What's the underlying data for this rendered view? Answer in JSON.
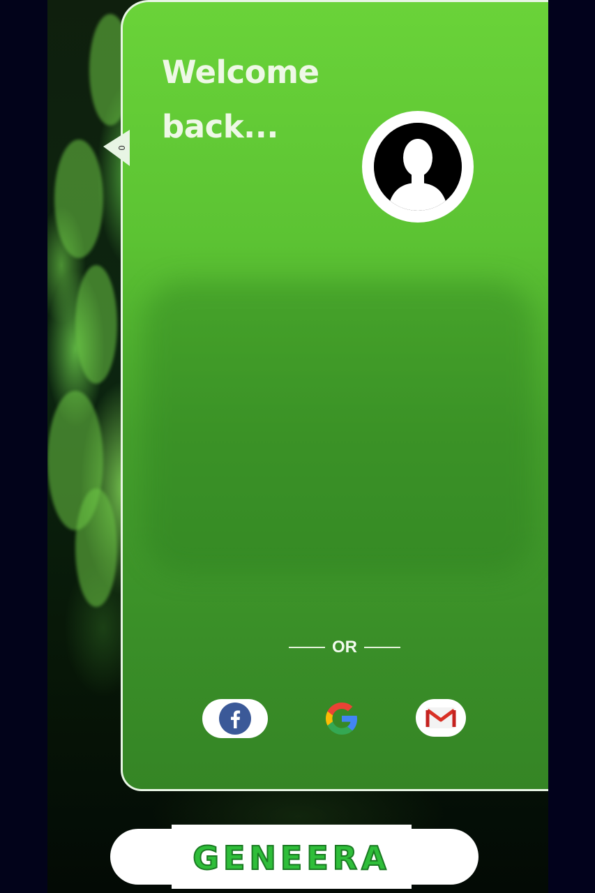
{
  "card": {
    "greeting": "Welcome back...",
    "greeting_line1": "Welcome",
    "greeting_line2": "back...",
    "side_tab_glyph": "0"
  },
  "divider": {
    "label": "OR"
  },
  "social": [
    {
      "name": "facebook",
      "icon": "facebook-icon",
      "color": "#3b5998"
    },
    {
      "name": "google",
      "icon": "google-icon",
      "color": "#4285f4"
    },
    {
      "name": "gmail",
      "icon": "gmail-icon",
      "color": "#d93025"
    }
  ],
  "brand": {
    "name": "GENEERA"
  },
  "colors": {
    "card_green": "#5cc333",
    "brand_green": "#2fbe3a",
    "background": "#03021a"
  }
}
